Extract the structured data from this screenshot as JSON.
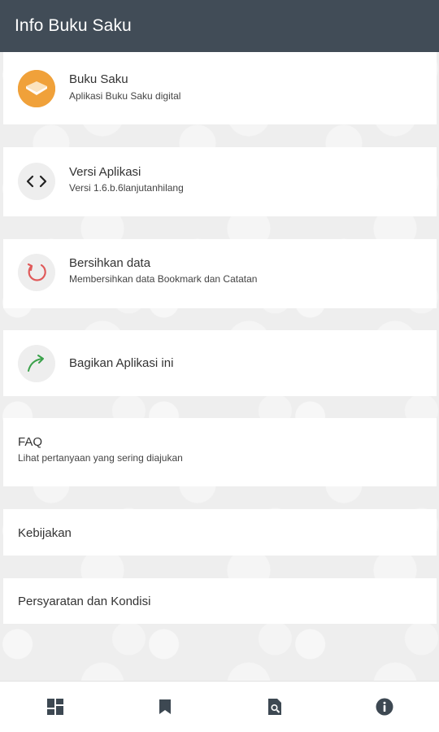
{
  "appbar": {
    "title": "Info Buku Saku"
  },
  "items": [
    {
      "title": "Buku Saku",
      "subtitle": "Aplikasi Buku Saku digital",
      "icon": "book-open-icon"
    },
    {
      "title": "Versi Aplikasi",
      "subtitle": "Versi 1.6.b.6lanjutanhilang",
      "icon": "code-icon"
    },
    {
      "title": "Bersihkan data",
      "subtitle": "Membersihkan data Bookmark dan Catatan",
      "icon": "refresh-icon"
    },
    {
      "title": "Bagikan Aplikasi ini",
      "icon": "share-arrow-icon"
    },
    {
      "title": "FAQ",
      "subtitle": "Lihat pertanyaan yang sering diajukan"
    },
    {
      "title": "Kebijakan"
    },
    {
      "title": "Persyaratan dan Kondisi"
    }
  ],
  "bottom_nav": [
    {
      "icon": "dashboard-icon"
    },
    {
      "icon": "bookmark-icon"
    },
    {
      "icon": "search-document-icon"
    },
    {
      "icon": "info-icon",
      "active": true
    }
  ],
  "colors": {
    "appbar": "#414c57",
    "accent_orange": "#f0a13a",
    "refresh_red": "#e05a5a",
    "share_green": "#3aa14a",
    "nav_icon": "#3d4852"
  }
}
